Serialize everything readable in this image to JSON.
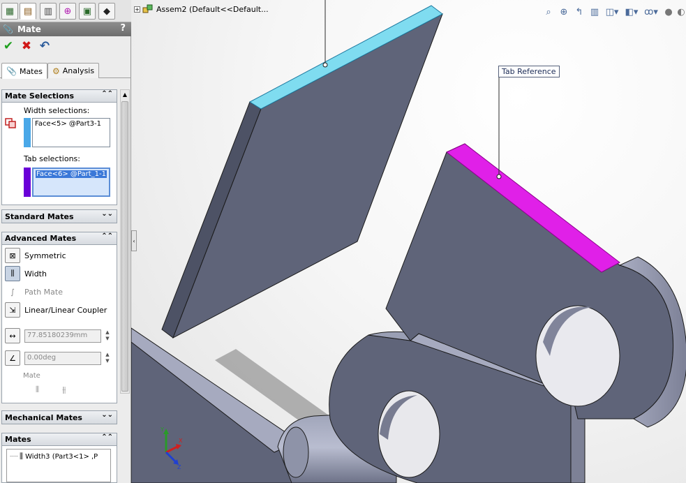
{
  "manager_tabs": [
    "feature-manager",
    "property-manager",
    "configuration-manager",
    "dimxpert-manager",
    "display-manager",
    "render-manager"
  ],
  "property_manager": {
    "title": "Mate",
    "help": "?",
    "actions": {
      "ok": "✔",
      "cancel": "✖",
      "undo": "↶"
    }
  },
  "sub_tabs": [
    {
      "label": "Mates",
      "active": true
    },
    {
      "label": "Analysis",
      "active": false
    }
  ],
  "mate_selections": {
    "header": "Mate Selections",
    "width_label": "Width selections:",
    "width_value": "Face<5> @Part3-1",
    "width_color": "#4aa8e8",
    "tab_label": "Tab selections:",
    "tab_value": "Face<6> @Part_1-1",
    "tab_color": "#6a00d8"
  },
  "standard_mates": {
    "header": "Standard Mates"
  },
  "advanced_mates": {
    "header": "Advanced Mates",
    "items": [
      {
        "label": "Symmetric",
        "state": "normal"
      },
      {
        "label": "Width",
        "state": "pressed"
      },
      {
        "label": "Path Mate",
        "state": "disabled"
      },
      {
        "label": "Linear/Linear Coupler",
        "state": "normal"
      }
    ],
    "distance_value": "77.85180239mm",
    "angle_value": "0.00deg",
    "mate_alignment_label": "Mate"
  },
  "mechanical_mates": {
    "header": "Mechanical Mates"
  },
  "mates": {
    "header": "Mates",
    "items": [
      "Width3 (Part3<1> ,P"
    ]
  },
  "viewport": {
    "tree_label": "Assem2  (Default<<Default...",
    "callout_tab": "Tab Reference",
    "face_width_color": "#7fdcf0",
    "face_tab_color": "#e020e8",
    "part_color": "#5f6479"
  }
}
